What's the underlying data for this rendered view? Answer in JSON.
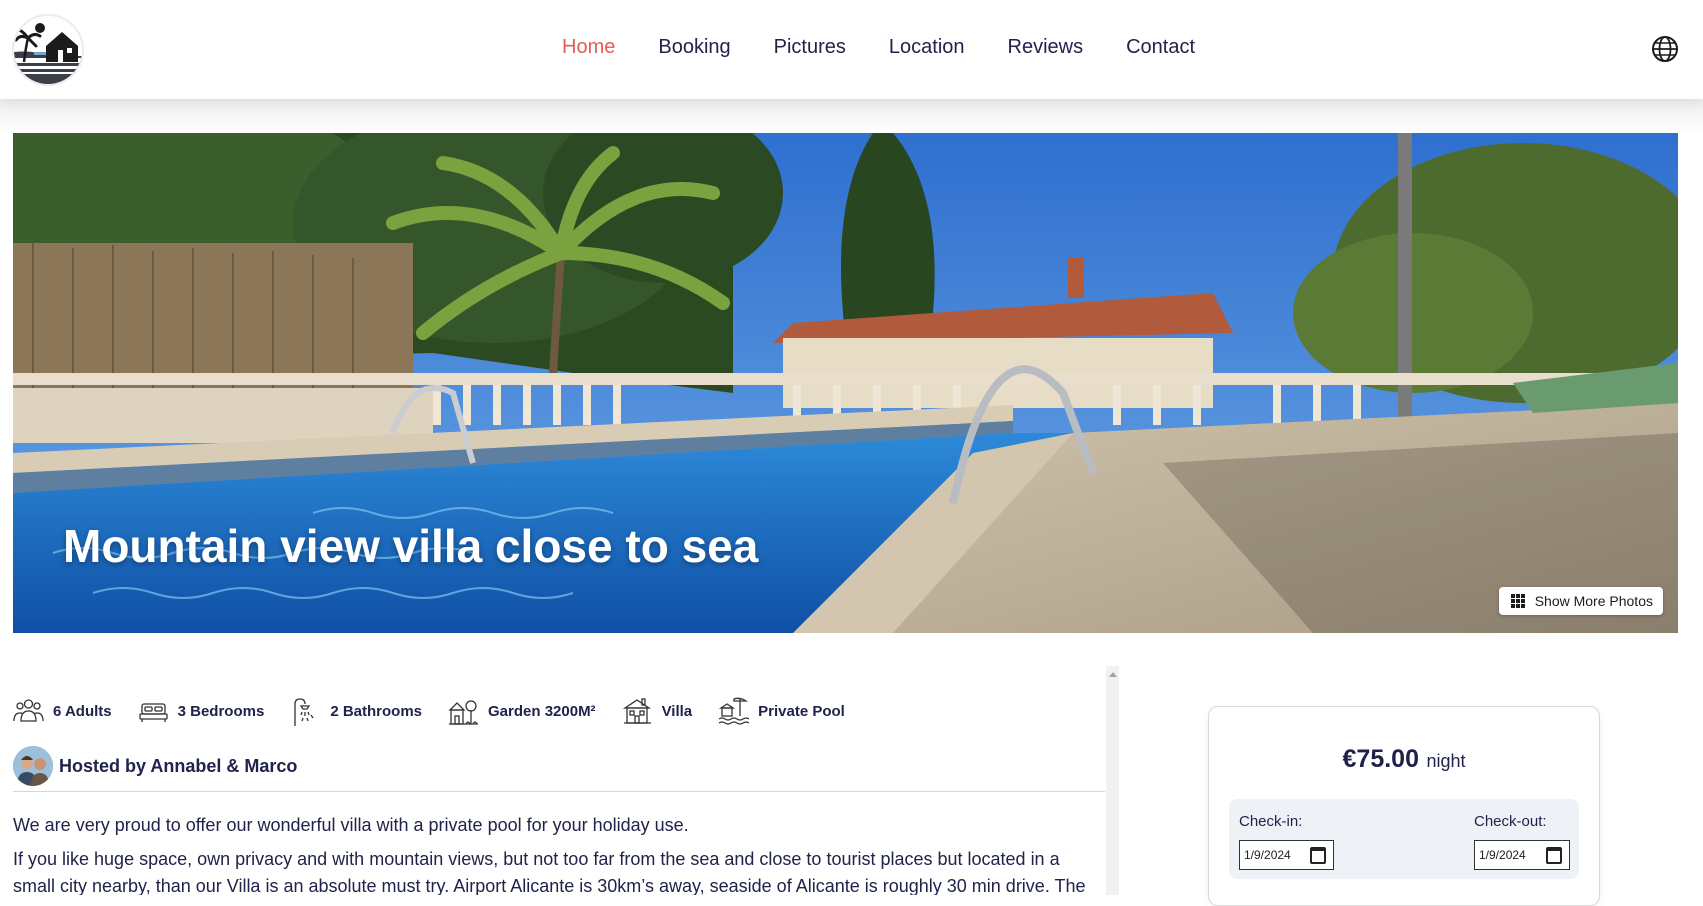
{
  "header": {
    "logo_icon": "villa-palm-logo",
    "nav": [
      {
        "label": "Home",
        "active": true
      },
      {
        "label": "Booking",
        "active": false
      },
      {
        "label": "Pictures",
        "active": false
      },
      {
        "label": "Location",
        "active": false
      },
      {
        "label": "Reviews",
        "active": false
      },
      {
        "label": "Contact",
        "active": false
      }
    ],
    "language_icon": "globe-icon",
    "active_color": "#e35d5b",
    "text_color": "#20234a"
  },
  "hero": {
    "title": "Mountain view villa close to sea",
    "show_more_label": "Show More Photos",
    "show_more_icon": "grid-icon"
  },
  "amenities": [
    {
      "icon": "adults-icon",
      "label": "6 Adults"
    },
    {
      "icon": "bed-icon",
      "label": "3 Bedrooms"
    },
    {
      "icon": "shower-icon",
      "label": "2 Bathrooms"
    },
    {
      "icon": "garden-icon",
      "label": "Garden 3200M²"
    },
    {
      "icon": "villa-icon",
      "label": "Villa"
    },
    {
      "icon": "pool-icon",
      "label": "Private Pool"
    }
  ],
  "host": {
    "label": "Hosted by Annabel & Marco"
  },
  "description": {
    "p1": "We are very proud to offer our wonderful villa with a private pool for your holiday use.",
    "p2": "If you like huge space, own privacy and with mountain views, but not too far from the sea and close to tourist places but located in a small city nearby, than our Villa is an absolute must try. Airport Alicante is 30km’s away, seaside of Alicante is roughly 30 min drive. The"
  },
  "booking": {
    "price": "€75.00",
    "price_unit": "night",
    "checkin_label": "Check-in:",
    "checkin_value": "1/9/2024",
    "checkout_label": "Check-out:",
    "checkout_value": "1/9/2024"
  }
}
